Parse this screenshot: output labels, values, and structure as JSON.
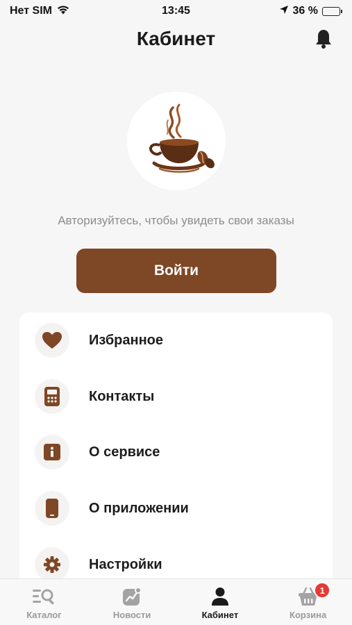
{
  "status_bar": {
    "carrier": "Нет SIM",
    "time": "13:45",
    "battery_percent": "36 %",
    "battery_level": 0.36
  },
  "header": {
    "title": "Кабинет"
  },
  "auth": {
    "hint": "Авторизуйтесь, чтобы увидеть свои заказы",
    "login_label": "Войти"
  },
  "menu": {
    "items": [
      {
        "label": "Избранное",
        "icon": "heart-icon"
      },
      {
        "label": "Контакты",
        "icon": "phone-icon"
      },
      {
        "label": "О сервисе",
        "icon": "info-icon"
      },
      {
        "label": "О приложении",
        "icon": "smartphone-icon"
      },
      {
        "label": "Настройки",
        "icon": "gear-icon"
      }
    ]
  },
  "tabs": [
    {
      "label": "Каталог",
      "icon": "catalog-icon",
      "active": false
    },
    {
      "label": "Новости",
      "icon": "news-icon",
      "active": false
    },
    {
      "label": "Кабинет",
      "icon": "profile-icon",
      "active": true
    },
    {
      "label": "Корзина",
      "icon": "cart-icon",
      "active": false,
      "badge": "1"
    }
  ],
  "colors": {
    "accent": "#7e4725",
    "badge": "#e53935",
    "battery": "#3ac24d"
  }
}
